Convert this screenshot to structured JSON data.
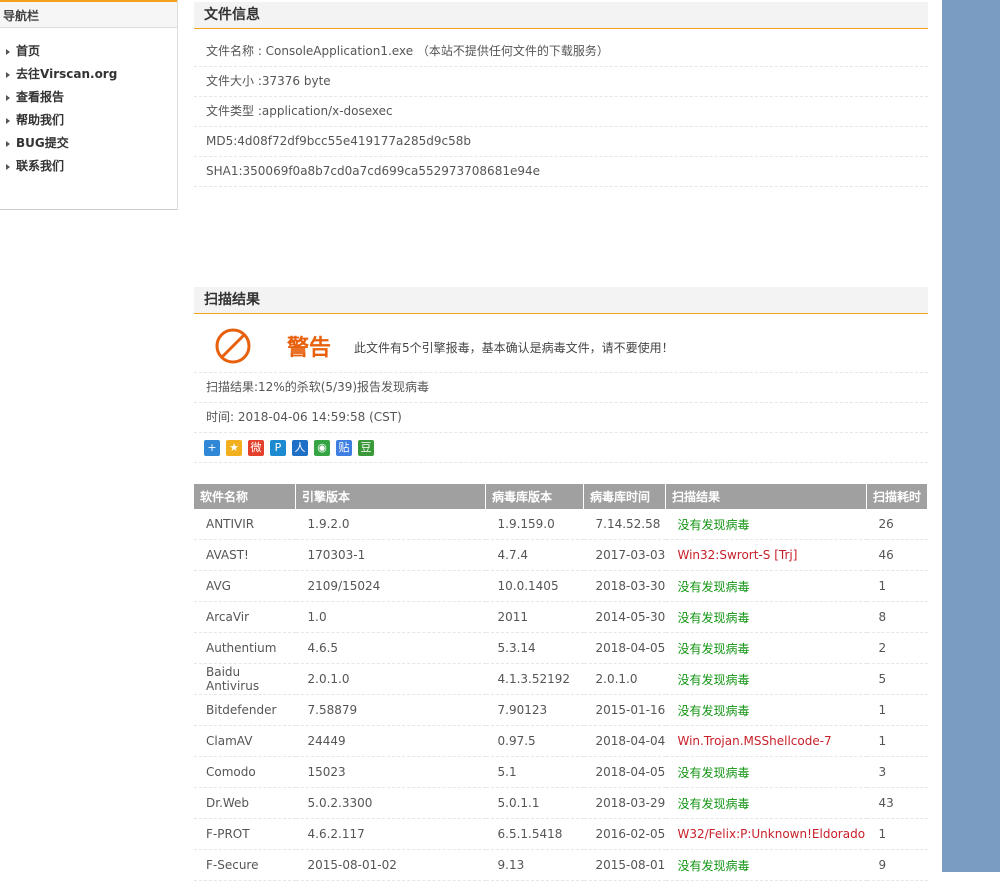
{
  "sidebar": {
    "title": "导航栏",
    "items": [
      "首页",
      "去往Virscan.org",
      "查看报告",
      "帮助我们",
      "BUG提交",
      "联系我们"
    ]
  },
  "file_info": {
    "heading": "文件信息",
    "name": "文件名称 : ConsoleApplication1.exe （本站不提供任何文件的下载服务）",
    "size": "文件大小 :37376 byte",
    "type": "文件类型 :application/x-dosexec",
    "md5": "MD5:4d08f72df9bcc55e419177a285d9c58b",
    "sha1": "SHA1:350069f0a8b7cd0a7cd699ca552973708681e94e"
  },
  "scan": {
    "heading": "扫描结果",
    "warning_label": "警告",
    "warning_text": "此文件有5个引擎报毒，基本确认是病毒文件，请不要使用！",
    "summary": "扫描结果:12%的杀软(5/39)报告发现病毒",
    "time": "时间: 2018-04-06 14:59:58 (CST)",
    "share_icons": [
      {
        "name": "share-more-icon",
        "glyph": "+",
        "color": "#2f87d6"
      },
      {
        "name": "share-qzone-icon",
        "glyph": "★",
        "color": "#f2b01e"
      },
      {
        "name": "share-weibo-icon",
        "glyph": "微",
        "color": "#e2402c"
      },
      {
        "name": "share-pengyou-icon",
        "glyph": "P",
        "color": "#1b8ad0"
      },
      {
        "name": "share-renren-icon",
        "glyph": "人",
        "color": "#1e6fc6"
      },
      {
        "name": "share-wechat-icon",
        "glyph": "◉",
        "color": "#35a544"
      },
      {
        "name": "share-tieba-icon",
        "glyph": "贴",
        "color": "#3d7ee0"
      },
      {
        "name": "share-douban-icon",
        "glyph": "豆",
        "color": "#3a9a3a"
      }
    ],
    "warn_color": "#e8600c",
    "clean_color": "#139513",
    "infected_color": "#c8202a"
  },
  "table": {
    "columns": [
      "软件名称",
      "引擎版本",
      "病毒库版本",
      "病毒库时间",
      "扫描结果",
      "扫描耗时"
    ],
    "rows": [
      {
        "name": "ANTIVIR",
        "engine": "1.9.2.0",
        "db": "1.9.159.0",
        "db_time": "7.14.52.58",
        "result": "没有发现病毒",
        "infected": false,
        "time": "26"
      },
      {
        "name": "AVAST!",
        "engine": "170303-1",
        "db": "4.7.4",
        "db_time": "2017-03-03",
        "result": "Win32:Swrort-S [Trj]",
        "infected": true,
        "time": "46"
      },
      {
        "name": "AVG",
        "engine": "2109/15024",
        "db": "10.0.1405",
        "db_time": "2018-03-30",
        "result": "没有发现病毒",
        "infected": false,
        "time": "1"
      },
      {
        "name": "ArcaVir",
        "engine": "1.0",
        "db": "2011",
        "db_time": "2014-05-30",
        "result": "没有发现病毒",
        "infected": false,
        "time": "8"
      },
      {
        "name": "Authentium",
        "engine": "4.6.5",
        "db": "5.3.14",
        "db_time": "2018-04-05",
        "result": "没有发现病毒",
        "infected": false,
        "time": "2"
      },
      {
        "name": "Baidu Antivirus",
        "engine": "2.0.1.0",
        "db": "4.1.3.52192",
        "db_time": "2.0.1.0",
        "result": "没有发现病毒",
        "infected": false,
        "time": "5"
      },
      {
        "name": "Bitdefender",
        "engine": "7.58879",
        "db": "7.90123",
        "db_time": "2015-01-16",
        "result": "没有发现病毒",
        "infected": false,
        "time": "1"
      },
      {
        "name": "ClamAV",
        "engine": "24449",
        "db": "0.97.5",
        "db_time": "2018-04-04",
        "result": "Win.Trojan.MSShellcode-7",
        "infected": true,
        "time": "1"
      },
      {
        "name": "Comodo",
        "engine": "15023",
        "db": "5.1",
        "db_time": "2018-04-05",
        "result": "没有发现病毒",
        "infected": false,
        "time": "3"
      },
      {
        "name": "Dr.Web",
        "engine": "5.0.2.3300",
        "db": "5.0.1.1",
        "db_time": "2018-03-29",
        "result": "没有发现病毒",
        "infected": false,
        "time": "43"
      },
      {
        "name": "F-PROT",
        "engine": "4.6.2.117",
        "db": "6.5.1.5418",
        "db_time": "2016-02-05",
        "result": "W32/Felix:P:Unknown!Eldorado",
        "infected": true,
        "time": "1"
      },
      {
        "name": "F-Secure",
        "engine": "2015-08-01-02",
        "db": "9.13",
        "db_time": "2015-08-01",
        "result": "没有发现病毒",
        "infected": false,
        "time": "9"
      }
    ]
  }
}
